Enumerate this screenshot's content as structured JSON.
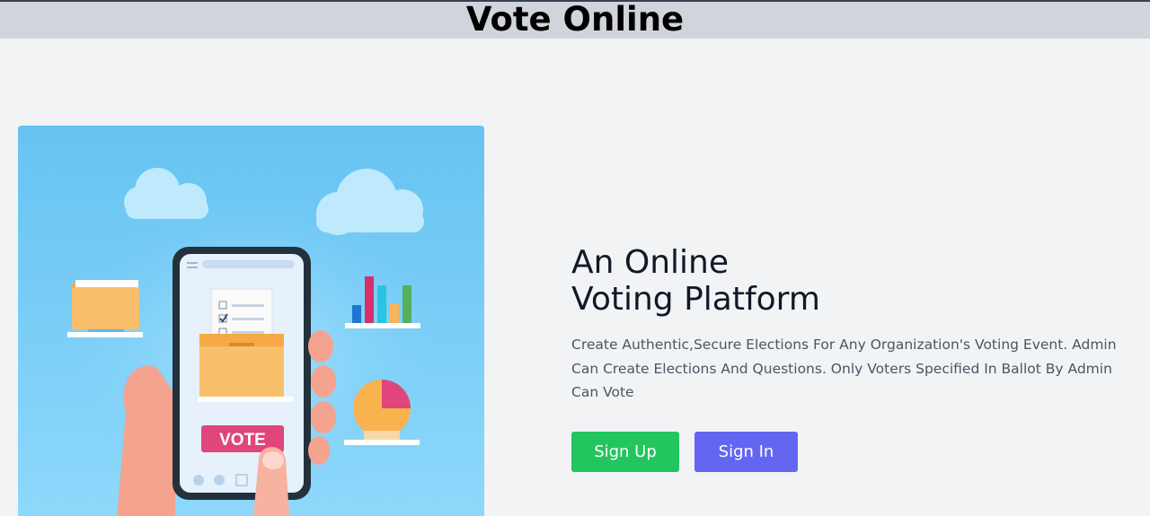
{
  "header": {
    "title": "Vote Online"
  },
  "hero": {
    "headline_line1": "An Online",
    "headline_line2": "Voting Platform",
    "description": "Create Authentic,Secure Elections For Any Organization's Voting Event. Admin Can Create Elections And Questions. Only Voters Specified In Ballot By Admin Can Vote",
    "illustration": {
      "vote_label": "VOTE",
      "colors": {
        "sky": "#6cc8f4",
        "vote_button": "#e0457b",
        "ballot_box": "#f7c36a"
      }
    }
  },
  "actions": {
    "sign_up_label": "Sign Up",
    "sign_in_label": "Sign In"
  },
  "colors": {
    "sign_up": "#22c55e",
    "sign_in": "#6366f1",
    "header_bg": "#d1d5db",
    "page_bg": "#f2f3f5"
  }
}
